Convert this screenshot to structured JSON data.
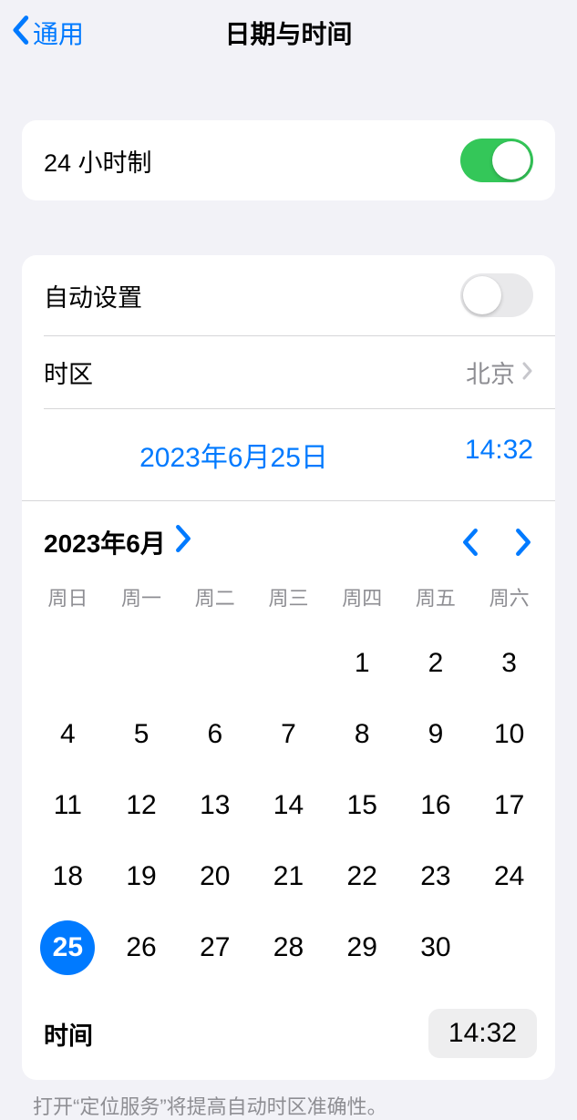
{
  "header": {
    "back_label": "通用",
    "title": "日期与时间"
  },
  "twenty_four_hour": {
    "label": "24 小时制",
    "enabled": true
  },
  "auto_set": {
    "label": "自动设置",
    "enabled": false
  },
  "timezone": {
    "label": "时区",
    "value": "北京"
  },
  "current": {
    "date_display": "2023年6月25日",
    "time_display": "14:32"
  },
  "calendar": {
    "month_label": "2023年6月",
    "weekdays": [
      "周日",
      "周一",
      "周二",
      "周三",
      "周四",
      "周五",
      "周六"
    ],
    "leading_blanks": 4,
    "days_in_month": 30,
    "selected_day": 25
  },
  "time_row": {
    "label": "时间",
    "value": "14:32"
  },
  "footer_note": "打开“定位服务”将提高自动时区准确性。"
}
